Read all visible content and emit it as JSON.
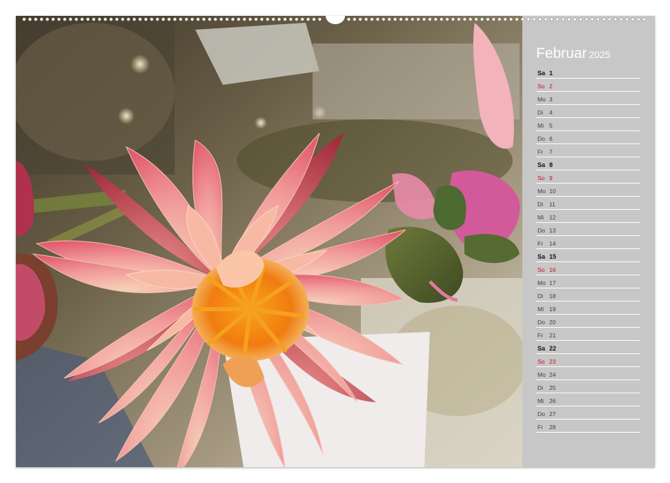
{
  "calendar": {
    "month": "Februar",
    "year": "2025",
    "days": [
      {
        "wd": "Sa",
        "d": "1",
        "type": "sat"
      },
      {
        "wd": "So",
        "d": "2",
        "type": "sun"
      },
      {
        "wd": "Mo",
        "d": "3",
        "type": "week"
      },
      {
        "wd": "Di",
        "d": "4",
        "type": "week"
      },
      {
        "wd": "Mi",
        "d": "5",
        "type": "week"
      },
      {
        "wd": "Do",
        "d": "6",
        "type": "week"
      },
      {
        "wd": "Fr",
        "d": "7",
        "type": "week"
      },
      {
        "wd": "Sa",
        "d": "8",
        "type": "sat"
      },
      {
        "wd": "So",
        "d": "9",
        "type": "sun"
      },
      {
        "wd": "Mo",
        "d": "10",
        "type": "week"
      },
      {
        "wd": "Di",
        "d": "11",
        "type": "week"
      },
      {
        "wd": "Mi",
        "d": "12",
        "type": "week"
      },
      {
        "wd": "Do",
        "d": "13",
        "type": "week"
      },
      {
        "wd": "Fr",
        "d": "14",
        "type": "week"
      },
      {
        "wd": "Sa",
        "d": "15",
        "type": "sat"
      },
      {
        "wd": "So",
        "d": "16",
        "type": "sun"
      },
      {
        "wd": "Mo",
        "d": "17",
        "type": "week"
      },
      {
        "wd": "Di",
        "d": "18",
        "type": "week"
      },
      {
        "wd": "Mi",
        "d": "19",
        "type": "week"
      },
      {
        "wd": "Do",
        "d": "20",
        "type": "week"
      },
      {
        "wd": "Fr",
        "d": "21",
        "type": "week"
      },
      {
        "wd": "Sa",
        "d": "22",
        "type": "sat"
      },
      {
        "wd": "So",
        "d": "23",
        "type": "sun"
      },
      {
        "wd": "Mo",
        "d": "24",
        "type": "week"
      },
      {
        "wd": "Di",
        "d": "25",
        "type": "week"
      },
      {
        "wd": "Mi",
        "d": "26",
        "type": "week"
      },
      {
        "wd": "Do",
        "d": "27",
        "type": "week"
      },
      {
        "wd": "Fr",
        "d": "28",
        "type": "week"
      }
    ]
  },
  "colors": {
    "panel": "#c7c7c7",
    "sunday": "#c0121b",
    "saturday": "#111111",
    "weekday": "#3d3d3d",
    "rule": "#ffffff"
  },
  "photo": {
    "subject": "water-lily"
  }
}
